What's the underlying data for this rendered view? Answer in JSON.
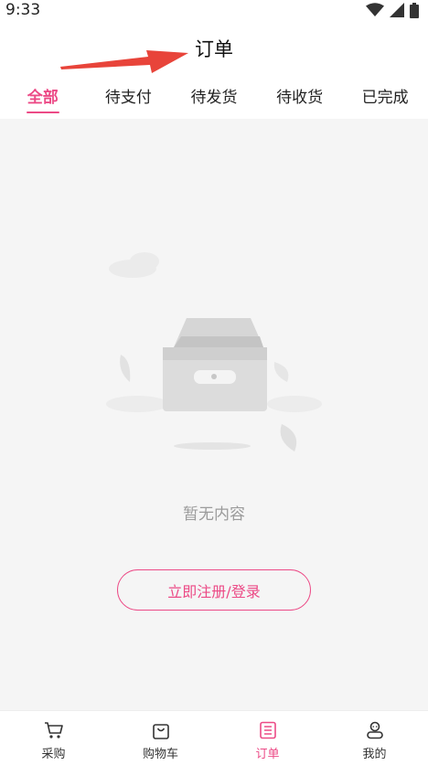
{
  "status_bar": {
    "time": "9:33",
    "icons": [
      "wifi-icon",
      "signal-icon",
      "battery-icon"
    ]
  },
  "header": {
    "title": "订单"
  },
  "annotation": {
    "icon": "red-arrow-icon",
    "color": "#e8443a"
  },
  "tabs": [
    {
      "label": "全部",
      "active": true
    },
    {
      "label": "待支付",
      "active": false
    },
    {
      "label": "待发货",
      "active": false
    },
    {
      "label": "待收货",
      "active": false
    },
    {
      "label": "已完成",
      "active": false
    }
  ],
  "empty_state": {
    "illustration": "empty-box-icon",
    "text": "暂无内容",
    "button_label": "立即注册/登录"
  },
  "bottom_nav": [
    {
      "label": "采购",
      "icon": "cart-icon",
      "active": false
    },
    {
      "label": "购物车",
      "icon": "shopping-bag-icon",
      "active": false
    },
    {
      "label": "订单",
      "icon": "order-list-icon",
      "active": true
    },
    {
      "label": "我的",
      "icon": "profile-icon",
      "active": false
    }
  ],
  "colors": {
    "accent": "#ec4a86",
    "background": "#f5f5f5",
    "muted_text": "#9b9b9b"
  }
}
